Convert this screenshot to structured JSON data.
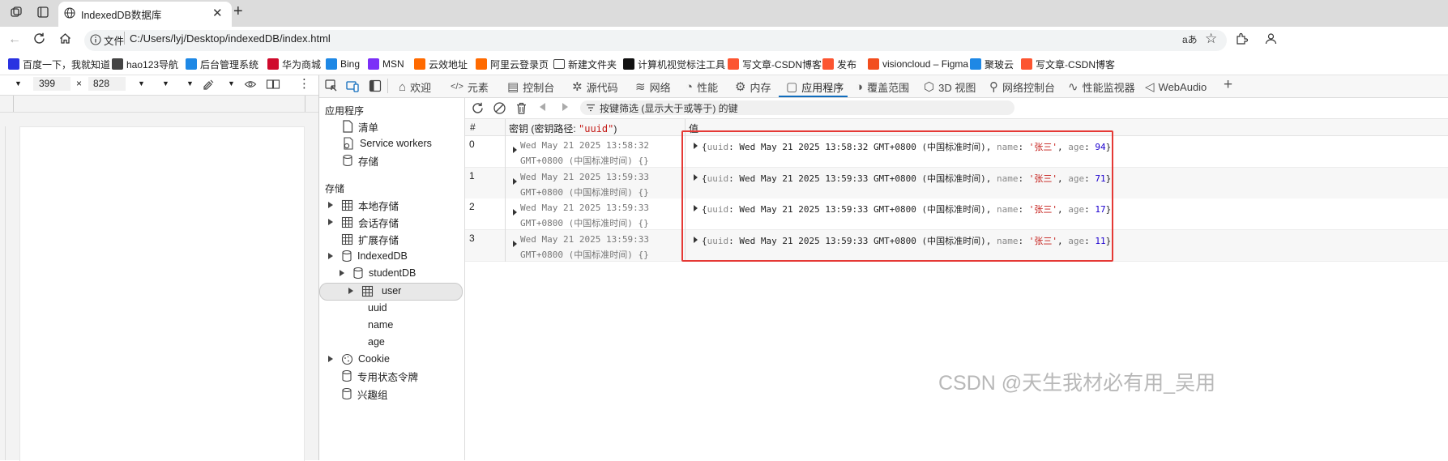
{
  "browser": {
    "tab_title": "IndexedDB数据库",
    "file_label": "文件",
    "url": "C:/Users/lyj/Desktop/indexedDB/index.html",
    "read_aloud": "aあ"
  },
  "bookmarks": [
    {
      "label": "百度一下，我就知道",
      "color": "#2932e1"
    },
    {
      "label": "hao123导航",
      "color": "#444444"
    },
    {
      "label": "后台管理系统",
      "color": "#1e88e5"
    },
    {
      "label": "华为商城",
      "color": "#cf0a2c"
    },
    {
      "label": "Bing",
      "color": "#1e88e5"
    },
    {
      "label": "MSN",
      "color": "#7b2ff7"
    },
    {
      "label": "云效地址",
      "color": "#ff6a00"
    },
    {
      "label": "阿里云登录页",
      "color": "#ff6a00"
    },
    {
      "label": "新建文件夹",
      "color": "#444444"
    },
    {
      "label": "计算机视觉标注工具",
      "color": "#111111"
    },
    {
      "label": "写文章-CSDN博客",
      "color": "#fc5531"
    },
    {
      "label": "发布",
      "color": "#fc5531"
    },
    {
      "label": "visioncloud – Figma",
      "color": "#f24e1e"
    },
    {
      "label": "聚玻云",
      "color": "#1e88e5"
    },
    {
      "label": "写文章-CSDN博客",
      "color": "#fc5531"
    }
  ],
  "device": {
    "width": "399",
    "height": "828",
    "times": "×"
  },
  "devtools_tabs": [
    "欢迎",
    "元素",
    "控制台",
    "源代码",
    "网络",
    "性能",
    "内存",
    "应用程序",
    "覆盖范围",
    "3D 视图",
    "网络控制台",
    "性能监视器",
    "WebAudio"
  ],
  "sidebar": {
    "app_header": "应用程序",
    "app_items": [
      "清单",
      "Service workers",
      "存储"
    ],
    "storage_header": "存储",
    "storage_items": [
      "本地存储",
      "会话存储",
      "扩展存储",
      "IndexedDB"
    ],
    "db_name": "studentDB",
    "store_name": "user",
    "index_items": [
      "uuid",
      "name",
      "age"
    ],
    "other_items": [
      "Cookie",
      "专用状态令牌",
      "兴趣组"
    ]
  },
  "table": {
    "filter_placeholder": "按键筛选 (显示大于或等于) 的键",
    "col_num": "#",
    "col_key_prefix": "密钥 (密钥路径: ",
    "col_key_path": "\"uuid\"",
    "col_key_suffix": ")",
    "col_value": "值",
    "rows": [
      {
        "num": "0",
        "key1": "Wed May 21 2025 13:58:32",
        "key2": "GMT+0800 (中国标准时间) {}",
        "uuid": "Wed May 21 2025 13:58:32 GMT+0800 (中国标准时间)",
        "name": "'张三'",
        "age": "94"
      },
      {
        "num": "1",
        "key1": "Wed May 21 2025 13:59:33",
        "key2": "GMT+0800 (中国标准时间) {}",
        "uuid": "Wed May 21 2025 13:59:33 GMT+0800 (中国标准时间)",
        "name": "'张三'",
        "age": "71"
      },
      {
        "num": "2",
        "key1": "Wed May 21 2025 13:59:33",
        "key2": "GMT+0800 (中国标准时间) {}",
        "uuid": "Wed May 21 2025 13:59:33 GMT+0800 (中国标准时间)",
        "name": "'张三'",
        "age": "17"
      },
      {
        "num": "3",
        "key1": "Wed May 21 2025 13:59:33",
        "key2": "GMT+0800 (中国标准时间) {}",
        "uuid": "Wed May 21 2025 13:59:33 GMT+0800 (中国标准时间)",
        "name": "'张三'",
        "age": "11"
      }
    ],
    "k_uuid": "uuid",
    "k_name": "name",
    "k_age": "age"
  },
  "watermark": "CSDN @天生我材必有用_吴用",
  "colors": {
    "accent": "#0f6cbd",
    "highlight_box": "#e53935"
  }
}
